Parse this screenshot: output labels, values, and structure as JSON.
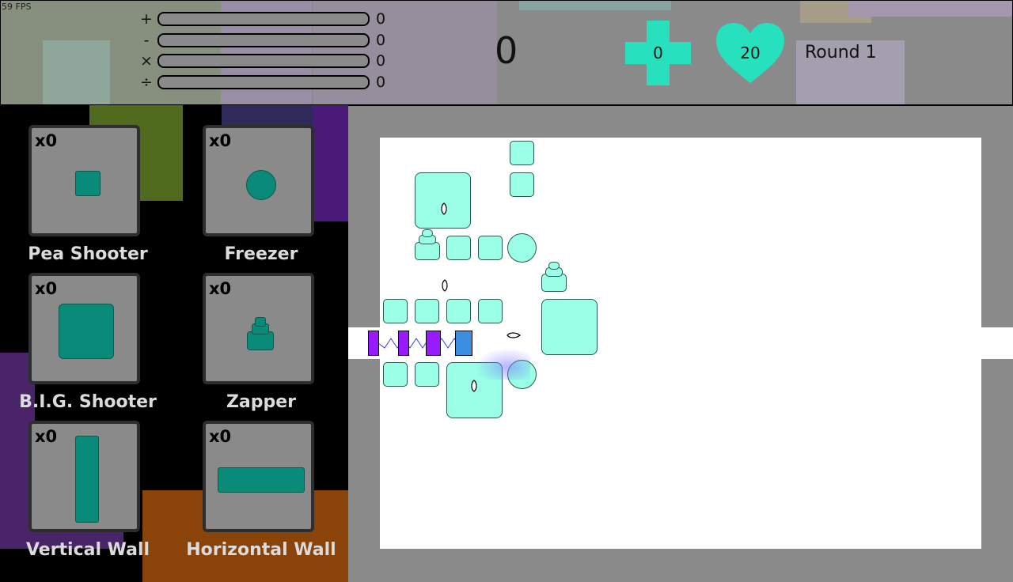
{
  "fps": "59 FPS",
  "operators": [
    {
      "symbol": "+",
      "value": "0"
    },
    {
      "symbol": "-",
      "value": "0"
    },
    {
      "symbol": "×",
      "value": "0"
    },
    {
      "symbol": "÷",
      "value": "0"
    }
  ],
  "score": "0",
  "coins": "0",
  "lives": "20",
  "round": "Round 1",
  "shop": [
    {
      "count": "x0",
      "label": "Pea Shooter"
    },
    {
      "count": "x0",
      "label": "Freezer"
    },
    {
      "count": "x0",
      "label": "B.I.G. Shooter"
    },
    {
      "count": "x0",
      "label": "Zapper"
    },
    {
      "count": "x0",
      "label": "Vertical Wall"
    },
    {
      "count": "x0",
      "label": "Horizontal Wall"
    }
  ],
  "colors": {
    "accent": "#26e0be",
    "tower_fill": "#9affe6",
    "item_fill": "#0a8a78",
    "enemy": "#9a1aff",
    "enemy_frozen": "#3b8fe0",
    "panel_gray": "#8a8a8a"
  }
}
